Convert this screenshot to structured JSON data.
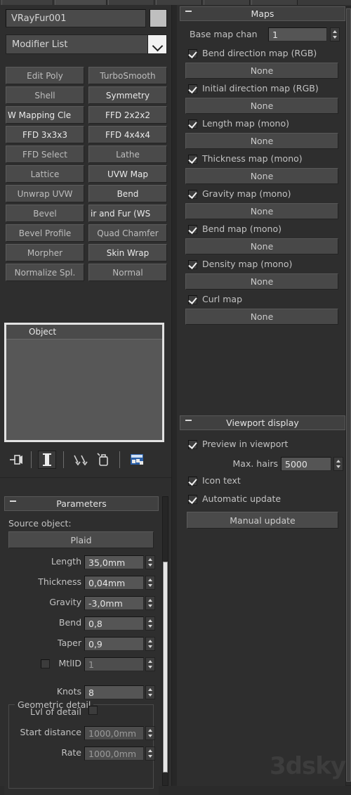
{
  "window": {
    "app": "3ds Max command panel — VRayFur modifier",
    "watermark": "3dsky"
  },
  "object": {
    "name_value": "VRayFur001",
    "color_swatch": "#bfbfbf",
    "modifier_list_label": "Modifier List"
  },
  "modifier_buttons": [
    {
      "label": "Edit Poly",
      "highlight": false
    },
    {
      "label": "TurboSmooth",
      "highlight": false
    },
    {
      "label": "Shell",
      "highlight": false
    },
    {
      "label": "Symmetry",
      "highlight": true
    },
    {
      "label": "W Mapping Cle",
      "highlight": true,
      "clipped": true
    },
    {
      "label": "FFD 2x2x2",
      "highlight": true
    },
    {
      "label": "FFD 3x3x3",
      "highlight": true
    },
    {
      "label": "FFD 4x4x4",
      "highlight": true
    },
    {
      "label": "FFD Select",
      "highlight": false
    },
    {
      "label": "Lathe",
      "highlight": false
    },
    {
      "label": "Lattice",
      "highlight": false
    },
    {
      "label": "UVW Map",
      "highlight": true
    },
    {
      "label": "Unwrap UVW",
      "highlight": false
    },
    {
      "label": "Bend",
      "highlight": true
    },
    {
      "label": "Bevel",
      "highlight": false
    },
    {
      "label": "ir and Fur (WS",
      "highlight": true,
      "clipped": true
    },
    {
      "label": "Bevel Profile",
      "highlight": false
    },
    {
      "label": "Quad Chamfer",
      "highlight": false
    },
    {
      "label": "Morpher",
      "highlight": false
    },
    {
      "label": "Skin Wrap",
      "highlight": true
    },
    {
      "label": "Normalize Spl.",
      "highlight": false
    },
    {
      "label": "Normal",
      "highlight": false
    }
  ],
  "stack": {
    "header": "Object",
    "items": [],
    "toolbar": [
      {
        "icon": "pin-stack-icon",
        "pressed": false
      },
      {
        "icon": "show-end-result-icon",
        "pressed": true
      },
      {
        "icon": "make-unique-icon",
        "pressed": false
      },
      {
        "icon": "remove-modifier-icon",
        "pressed": false
      },
      {
        "icon": "configure-sets-icon",
        "pressed": false
      }
    ]
  },
  "parameters": {
    "title": "Parameters",
    "source_object_label": "Source object:",
    "source_object_value": "Plaid",
    "fields": [
      {
        "label": "Length",
        "value": "35,0mm",
        "disabled": false
      },
      {
        "label": "Thickness",
        "value": "0,04mm",
        "disabled": false
      },
      {
        "label": "Gravity",
        "value": "-3,0mm",
        "disabled": false
      },
      {
        "label": "Bend",
        "value": "0,8",
        "disabled": false
      },
      {
        "label": "Taper",
        "value": "0,9",
        "disabled": false
      }
    ],
    "mtlid": {
      "label": "MtlID",
      "checked": false,
      "value": "1",
      "disabled": true
    },
    "geometric_detail": {
      "title": "Geometric detail",
      "knots": {
        "label": "Knots",
        "value": "8",
        "disabled": false
      },
      "lvl_of_detail": {
        "label": "Lvl of detail",
        "checked": false
      },
      "start_distance": {
        "label": "Start distance",
        "value": "1000,0mm",
        "disabled": true
      },
      "rate": {
        "label": "Rate",
        "value": "1000,0mm",
        "disabled": true
      }
    }
  },
  "maps": {
    "title": "Maps",
    "base_map_channel": {
      "label": "Base map chan",
      "value": "1"
    },
    "slots": [
      {
        "label": "Bend direction map (RGB)",
        "checked": true,
        "button": "None"
      },
      {
        "label": "Initial direction map (RGB)",
        "checked": true,
        "button": "None"
      },
      {
        "label": "Length map (mono)",
        "checked": true,
        "button": "None"
      },
      {
        "label": "Thickness map (mono)",
        "checked": true,
        "button": "None"
      },
      {
        "label": "Gravity map (mono)",
        "checked": true,
        "button": "None"
      },
      {
        "label": "Bend map (mono)",
        "checked": true,
        "button": "None"
      },
      {
        "label": "Density map (mono)",
        "checked": true,
        "button": "None"
      },
      {
        "label": "Curl map",
        "checked": true,
        "button": "None"
      }
    ]
  },
  "viewport_display": {
    "title": "Viewport display",
    "preview_in_viewport": {
      "label": "Preview in viewport",
      "checked": true
    },
    "max_hairs": {
      "label": "Max. hairs",
      "value": "5000"
    },
    "icon_text": {
      "label": "Icon text",
      "checked": true
    },
    "automatic_update": {
      "label": "Automatic update",
      "checked": true
    },
    "manual_update_button": "Manual update"
  }
}
